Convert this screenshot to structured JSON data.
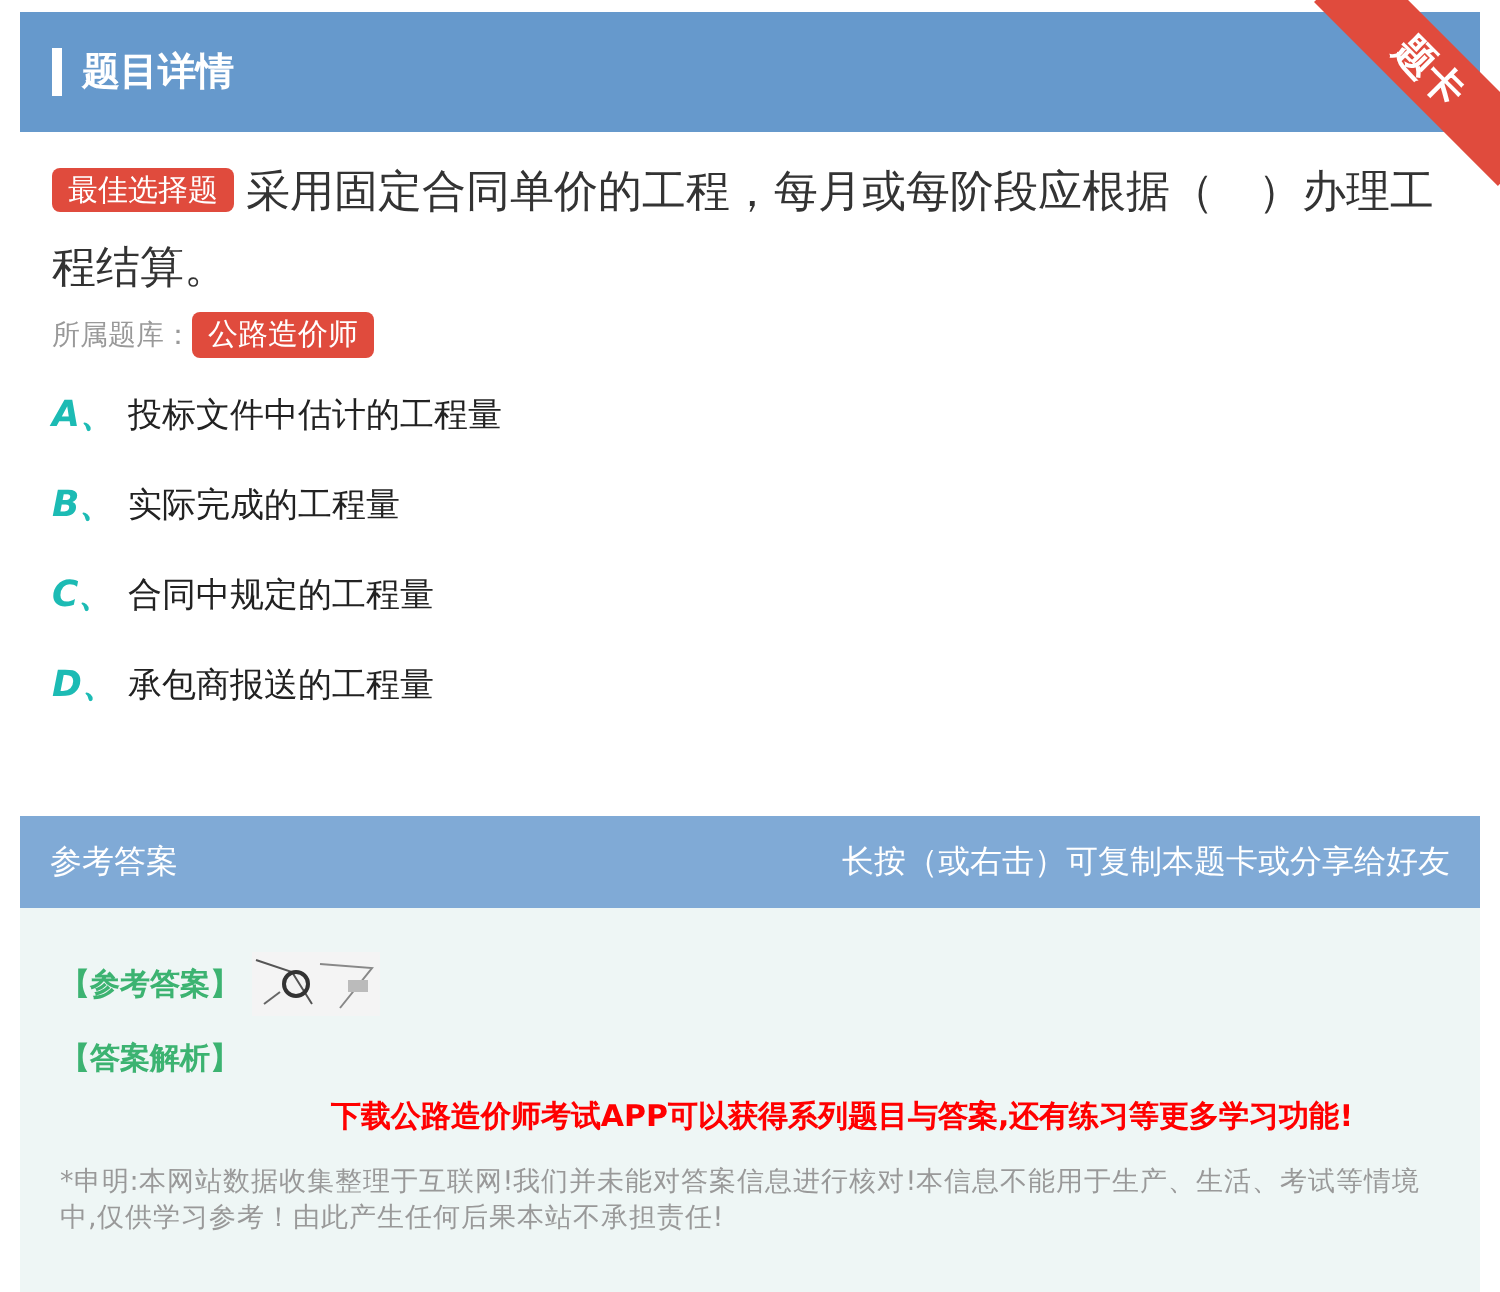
{
  "header": {
    "title": "题目详情",
    "ribbon": "题卡"
  },
  "question": {
    "type_badge": "最佳选择题",
    "text": "采用固定合同单价的工程，每月或每阶段应根据（　）办理工程结算。",
    "bank_label": "所属题库：",
    "bank": "公路造价师"
  },
  "options": [
    {
      "letter": "A、",
      "text": "投标文件中估计的工程量"
    },
    {
      "letter": "B、",
      "text": "实际完成的工程量"
    },
    {
      "letter": "C、",
      "text": "合同中规定的工程量"
    },
    {
      "letter": "D、",
      "text": "承包商报送的工程量"
    }
  ],
  "answer": {
    "title": "参考答案",
    "hint": "长按（或右击）可复制本题卡或分享给好友",
    "answer_label": "【参考答案】",
    "analysis_label": "【答案解析】",
    "promo": "下载公路造价师考试APP可以获得系列题目与答案,还有练习等更多学习功能!",
    "disclaimer": "*申明:本网站数据收集整理于互联网!我们并未能对答案信息进行核对!本信息不能用于生产、生活、考试等情境中,仅供学习参考！由此产生任何后果本站不承担责任!"
  }
}
